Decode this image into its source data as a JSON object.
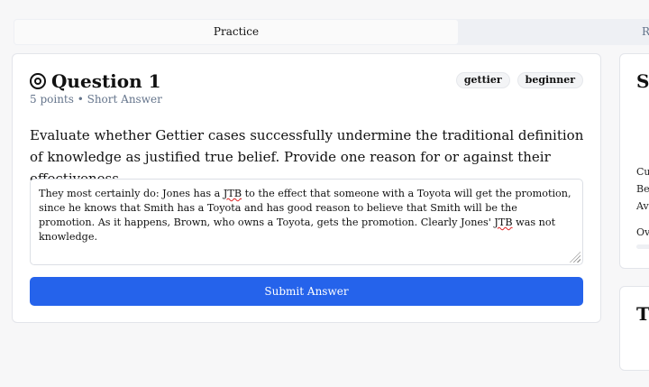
{
  "tabs": [
    "Practice",
    "Re"
  ],
  "question": {
    "title": "Question 1",
    "meta": "5 points • Short Answer",
    "tags": [
      "gettier",
      "beginner"
    ],
    "prompt": "Evaluate whether Gettier cases successfully undermine the traditional definition of knowledge as justified true belief. Provide one reason for or against their effectiveness.",
    "answer_parts": [
      "They most certainly do: Jones has a ",
      "JTB",
      " to the effect that someone with a Toyota will get the promotion, since he knows that Smith has a Toyota and has good reason to believe that Smith will be the promotion. As it happens, Brown, who owns a Toyota, gets the promotion. Clearly Jones' ",
      "JTB",
      " was not knowledge."
    ],
    "submit_label": "Submit Answer"
  },
  "sidebar": {
    "card1_title": "S",
    "lines": [
      "Cu",
      "Be",
      "Av",
      "Ov"
    ],
    "card2_title": "T"
  }
}
